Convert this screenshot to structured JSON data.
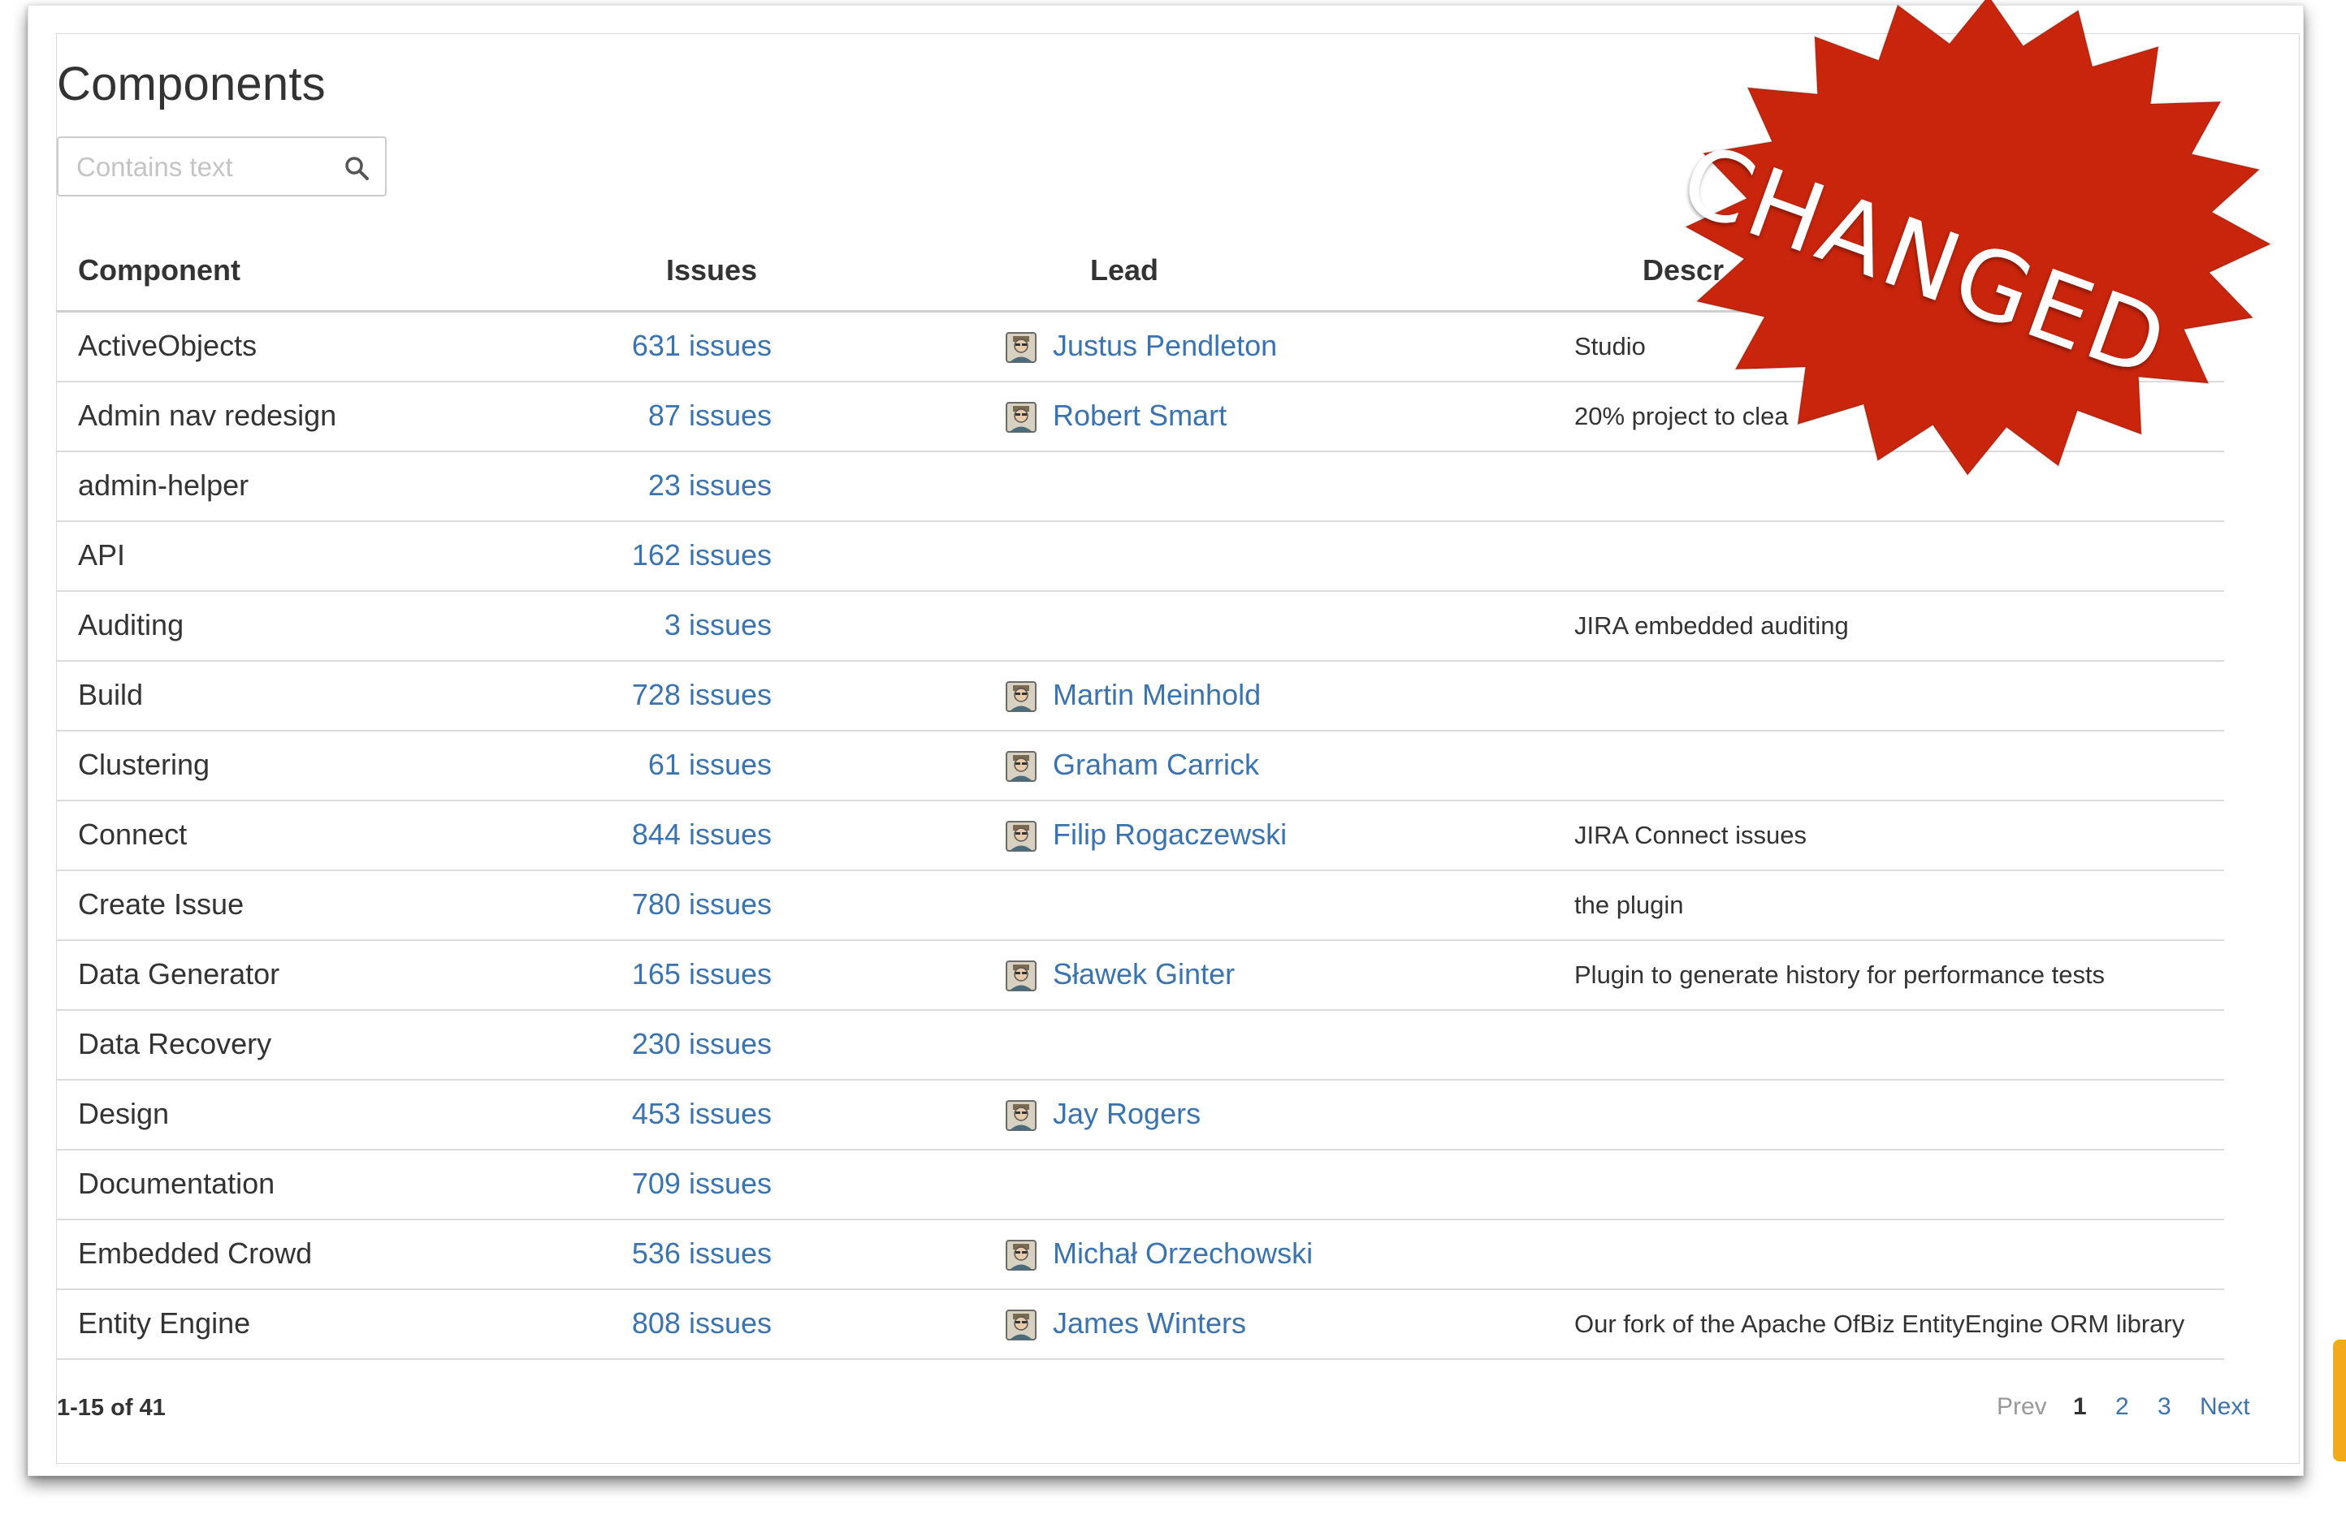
{
  "page": {
    "title": "Components"
  },
  "search": {
    "placeholder": "Contains text"
  },
  "table": {
    "headers": {
      "component": "Component",
      "issues": "Issues",
      "lead": "Lead",
      "description": "Descr"
    },
    "rows": [
      {
        "component": "ActiveObjects",
        "issues": "631 issues",
        "lead": "Justus Pendleton",
        "description": "Studio"
      },
      {
        "component": "Admin nav redesign",
        "issues": "87 issues",
        "lead": "Robert Smart",
        "description": "20% project to clea"
      },
      {
        "component": "admin-helper",
        "issues": "23 issues",
        "lead": "",
        "description": ""
      },
      {
        "component": "API",
        "issues": "162 issues",
        "lead": "",
        "description": ""
      },
      {
        "component": "Auditing",
        "issues": "3 issues",
        "lead": "",
        "description": "JIRA embedded auditing"
      },
      {
        "component": "Build",
        "issues": "728 issues",
        "lead": "Martin Meinhold",
        "description": ""
      },
      {
        "component": "Clustering",
        "issues": "61 issues",
        "lead": "Graham Carrick",
        "description": ""
      },
      {
        "component": "Connect",
        "issues": "844 issues",
        "lead": "Filip Rogaczewski",
        "description": "JIRA Connect issues"
      },
      {
        "component": "Create Issue",
        "issues": "780 issues",
        "lead": "",
        "description": "the plugin"
      },
      {
        "component": "Data Generator",
        "issues": "165 issues",
        "lead": "Sławek Ginter",
        "description": "Plugin to generate history for performance tests"
      },
      {
        "component": "Data Recovery",
        "issues": "230 issues",
        "lead": "",
        "description": ""
      },
      {
        "component": "Design",
        "issues": "453 issues",
        "lead": "Jay Rogers",
        "description": ""
      },
      {
        "component": "Documentation",
        "issues": "709 issues",
        "lead": "",
        "description": ""
      },
      {
        "component": "Embedded Crowd",
        "issues": "536 issues",
        "lead": "Michał Orzechowski",
        "description": ""
      },
      {
        "component": "Entity Engine",
        "issues": "808 issues",
        "lead": "James Winters",
        "description": "Our fork of the Apache OfBiz EntityEngine ORM library"
      }
    ]
  },
  "footer": {
    "count": "1-15 of 41"
  },
  "pagination": {
    "prev": "Prev",
    "pages": [
      "1",
      "2",
      "3"
    ],
    "next": "Next",
    "current": "1"
  },
  "stamp": {
    "text": "CHANGED"
  },
  "colors": {
    "link": "#3b73af",
    "stamp": "#c8250c",
    "text": "#333333"
  },
  "icons": {
    "search": "search-icon",
    "avatar": "user-avatar-icon"
  }
}
